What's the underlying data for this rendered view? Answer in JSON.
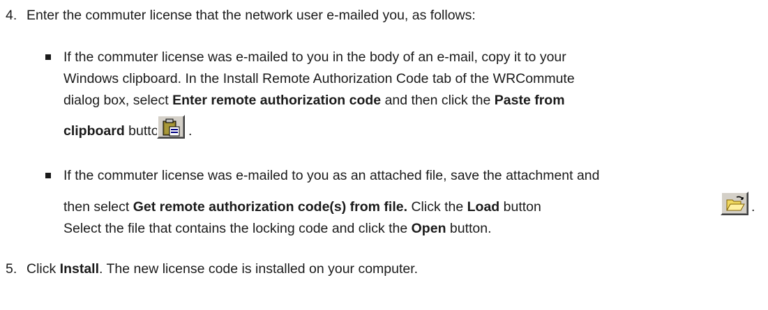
{
  "step4": {
    "number": "4.",
    "text": "Enter the commuter license that the network user e-mailed you, as follows:"
  },
  "bullet1": {
    "line1": "If the commuter license was e-mailed to you in the body of an e-mail, copy it to your",
    "line2": "Windows clipboard. In the Install Remote Authorization Code tab of the WRCommute",
    "line3_pre": "dialog box, select ",
    "line3_bold1": "Enter remote authorization code",
    "line3_mid": " and then click the ",
    "line3_bold2": "Paste from",
    "line4_bold": "clipboard",
    "line4_post": " button",
    "line4_end": ".",
    "button_icon": "paste-clipboard-icon"
  },
  "bullet2": {
    "line1": "If the commuter license was e-mailed to you as an attached file, save the attachment and",
    "line2_pre": "then select ",
    "line2_bold1": "Get remote authorization code(s) from file.",
    "line2_mid": " Click the ",
    "line2_bold2": "Load",
    "line2_post": " button",
    "line2_end": ".",
    "line3_pre": "Select the file that contains the locking code and click the ",
    "line3_bold": "Open",
    "line3_post": " button.",
    "button_icon": "open-folder-icon"
  },
  "step5": {
    "number": "5.",
    "pre": "Click ",
    "bold": "Install",
    "post": ". The new license code is installed on your computer."
  }
}
